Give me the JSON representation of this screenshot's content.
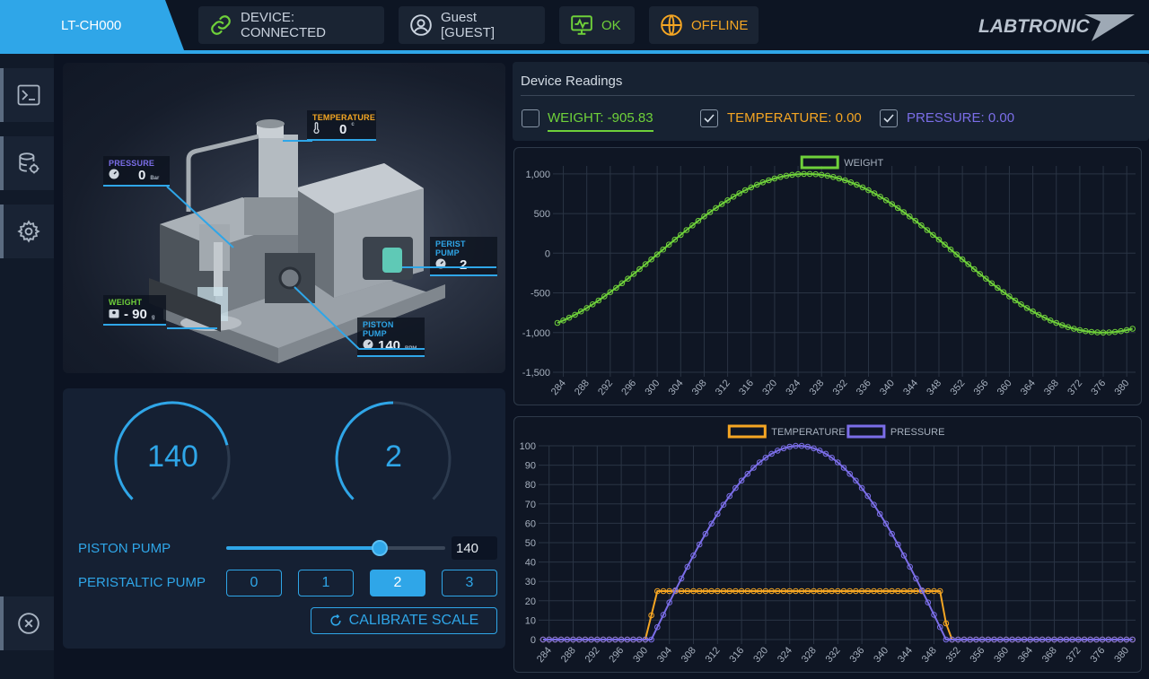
{
  "header": {
    "device_id": "LT-CH000",
    "status_device": "DEVICE: CONNECTED",
    "user": "Guest [GUEST]",
    "health": "OK",
    "network": "OFFLINE",
    "brand": "LABTRONIC",
    "colors": {
      "accent": "#2fa6e8",
      "ok": "#6fd13a",
      "offline": "#f5a623"
    }
  },
  "sidebar": {
    "items": [
      {
        "icon": "terminal-icon"
      },
      {
        "icon": "database-icon"
      },
      {
        "icon": "gear-icon"
      }
    ],
    "bottom_icon": "close-circle-icon"
  },
  "device_image": {
    "callouts": {
      "temperature": {
        "label": "TEMPERATURE",
        "value": "0",
        "unit": "c"
      },
      "pressure": {
        "label": "PRESSURE",
        "value": "0",
        "unit": "Bar"
      },
      "perist_pump": {
        "label": "PERIST PUMP",
        "value": "2"
      },
      "weight": {
        "label": "WEIGHT",
        "value": "- 90",
        "unit": "g"
      },
      "piston_pump": {
        "label": "PISTON PUMP",
        "value": "140",
        "unit": "RPM"
      }
    }
  },
  "controls": {
    "gauge_piston": {
      "value": "140",
      "fraction": 0.78
    },
    "gauge_perist": {
      "value": "2",
      "fraction": 0.5
    },
    "piston_label": "PISTON PUMP",
    "piston_slider": {
      "value": "140",
      "fraction": 0.7
    },
    "perist_label": "PERISTALTIC PUMP",
    "perist_options": [
      "0",
      "1",
      "2",
      "3"
    ],
    "perist_selected": "2",
    "calibrate_label": "CALIBRATE SCALE"
  },
  "readings": {
    "title": "Device Readings",
    "weight": {
      "label": "WEIGHT: -905.83",
      "checked": false,
      "color": "#6fd13a"
    },
    "temperature": {
      "label": "TEMPERATURE: 0.00",
      "checked": true,
      "color": "#f5a623"
    },
    "pressure": {
      "label": "PRESSURE: 0.00",
      "checked": true,
      "color": "#7b6ee8"
    }
  },
  "chart_data": [
    {
      "type": "line",
      "legend": [
        "WEIGHT"
      ],
      "x_ticks": [
        284,
        288,
        292,
        296,
        300,
        304,
        308,
        312,
        316,
        320,
        324,
        328,
        332,
        336,
        340,
        344,
        348,
        352,
        356,
        360,
        364,
        368,
        372,
        376,
        380
      ],
      "xlim": [
        283,
        381.5
      ],
      "ylim": [
        -1500,
        1100
      ],
      "y_ticks": [
        -1500,
        -1000,
        -500,
        0,
        500,
        1000
      ],
      "y_tick_labels": [
        "-1,500",
        "-1,000",
        "-500",
        "0",
        "500",
        "1,000"
      ],
      "series": [
        {
          "name": "WEIGHT",
          "color": "#6fd13a",
          "function": "sine",
          "amplitude": 1000,
          "peak_x": 325.5,
          "period": 101,
          "x_start": 283,
          "x_end": 381.5,
          "step": 1
        }
      ],
      "grid": true,
      "legend_position": "top"
    },
    {
      "type": "line",
      "legend": [
        "TEMPERATURE",
        "PRESSURE"
      ],
      "x_ticks": [
        284,
        288,
        292,
        296,
        300,
        304,
        308,
        312,
        316,
        320,
        324,
        328,
        332,
        336,
        340,
        344,
        348,
        352,
        356,
        360,
        364,
        368,
        372,
        376,
        380
      ],
      "xlim": [
        283,
        381.5
      ],
      "ylim": [
        0,
        100
      ],
      "y_ticks": [
        0,
        10,
        20,
        30,
        40,
        50,
        60,
        70,
        80,
        90,
        100
      ],
      "series": [
        {
          "name": "TEMPERATURE",
          "color": "#f5a623",
          "function": "step",
          "level": 25,
          "rise_start": 300.5,
          "rise_end": 301.5,
          "fall_start": 349,
          "fall_end": 350.5,
          "x_start": 283,
          "x_end": 381.5,
          "step": 1
        },
        {
          "name": "PRESSURE",
          "color": "#7b6ee8",
          "function": "dome",
          "peak": 100,
          "peak_x": 325.5,
          "start_x": 301,
          "end_x": 350,
          "x_start": 283,
          "x_end": 381.5,
          "step": 1
        }
      ],
      "grid": true,
      "legend_position": "top"
    }
  ]
}
